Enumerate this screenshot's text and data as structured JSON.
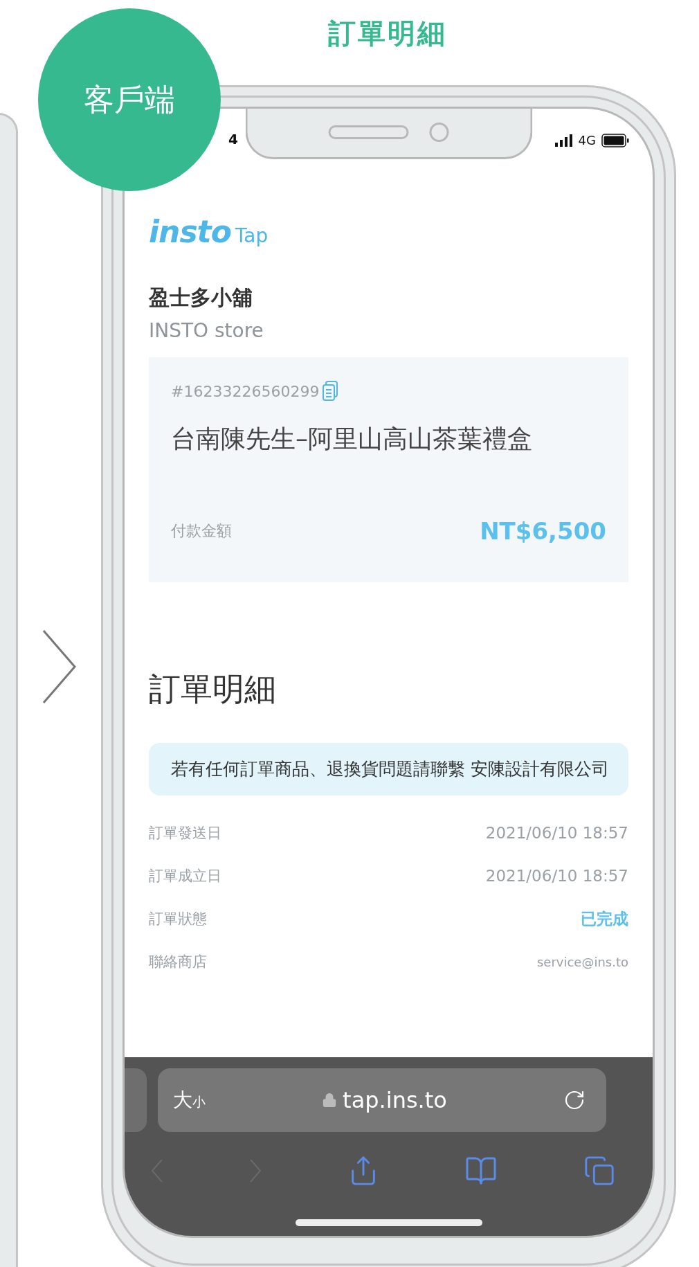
{
  "page_title": "訂單明細",
  "badge": "客戶端",
  "status_bar": {
    "time": "4",
    "network": "4G"
  },
  "logo": {
    "brand": "insto",
    "product": "Tap"
  },
  "store": {
    "name": "盈士多小舖",
    "subtitle": "INSTO store"
  },
  "order_card": {
    "order_number": "#16233226560299",
    "product": "台南陳先生–阿里山高山茶葉禮盒",
    "amount_label": "付款金額",
    "amount": "NT$6,500"
  },
  "section_title": "訂單明細",
  "notice": "若有任何訂單商品、退換貨問題請聯繫 安陳設計有限公司",
  "details": [
    {
      "label": "訂單發送日",
      "value": "2021/06/10 18:57",
      "kind": "plain"
    },
    {
      "label": "訂單成立日",
      "value": "2021/06/10 18:57",
      "kind": "plain"
    },
    {
      "label": "訂單狀態",
      "value": "已完成",
      "kind": "status"
    },
    {
      "label": "聯絡商店",
      "value": "service@ins.to",
      "kind": "email"
    }
  ],
  "browser": {
    "text_size_button": "大小",
    "url": "tap.ins.to",
    "back_disabled": true,
    "forward_disabled": true
  }
}
